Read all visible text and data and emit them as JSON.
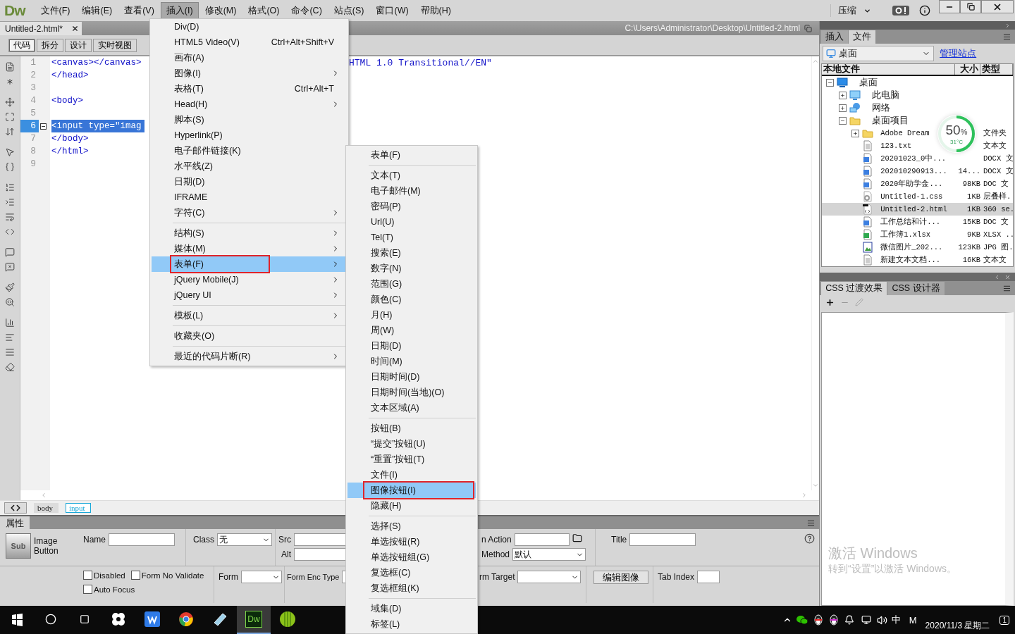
{
  "app": {
    "logo": "Dw"
  },
  "menubar": [
    {
      "label": "文件(F)",
      "selected": false
    },
    {
      "label": "编辑(E)",
      "selected": false
    },
    {
      "label": "查看(V)",
      "selected": false
    },
    {
      "label": "插入(I)",
      "selected": true
    },
    {
      "label": "修改(M)",
      "selected": false
    },
    {
      "label": "格式(O)",
      "selected": false
    },
    {
      "label": "命令(C)",
      "selected": false
    },
    {
      "label": "站点(S)",
      "selected": false
    },
    {
      "label": "窗口(W)",
      "selected": false
    },
    {
      "label": "帮助(H)",
      "selected": false
    }
  ],
  "workspace": {
    "label": "压缩"
  },
  "document": {
    "tab": "Untitled-2.html*",
    "path": "C:\\Users\\Administrator\\Desktop\\Untitled-2.html"
  },
  "view_buttons": [
    {
      "label": "代码",
      "selected": true
    },
    {
      "label": "拆分",
      "selected": false
    },
    {
      "label": "设计",
      "selected": false
    },
    {
      "label": "实时视图",
      "selected": false
    }
  ],
  "code_lines": [
    {
      "number": "1",
      "text": "<canvas></canvas>",
      "tail": "HTML 1.0 Transitional//EN\"",
      "selected": false,
      "foldable": false
    },
    {
      "number": "2",
      "text": "</head>",
      "selected": false,
      "foldable": false
    },
    {
      "number": "3",
      "selected": false,
      "foldable": false
    },
    {
      "number": "4",
      "text": "<body>",
      "selected": false,
      "foldable": false
    },
    {
      "number": "5",
      "selected": false,
      "foldable": false
    },
    {
      "number": "6",
      "text": "<input type=\"imag",
      "selected": true,
      "foldable": true
    },
    {
      "number": "7",
      "text": "</body>",
      "selected": false,
      "foldable": false
    },
    {
      "number": "8",
      "text": "</html>",
      "selected": false,
      "foldable": false
    },
    {
      "number": "9",
      "selected": false,
      "foldable": false
    }
  ],
  "tag_selector": [
    {
      "label": "body",
      "selected": false
    },
    {
      "label": "input",
      "selected": true
    }
  ],
  "properties": {
    "title": "属性",
    "element_icon_text": "Sub",
    "element_name": "Image Button",
    "name_label": "Name",
    "class": {
      "label": "Class",
      "value": "无"
    },
    "src_label": "Src",
    "alt_label": "Alt",
    "action_label": "n Action",
    "method": {
      "label": "Method",
      "value": "默认"
    },
    "title_label": "Title",
    "checkboxes": [
      {
        "label": "Disabled",
        "checked": false
      },
      {
        "label": "Form No Validate",
        "checked": false
      },
      {
        "label": "Auto Focus",
        "checked": false
      }
    ],
    "form_label": "Form",
    "enc_label": "Form Enc Type",
    "target_label": "rm Target",
    "edit_button": "编辑图像",
    "tab_index_label": "Tab Index"
  },
  "insert_menu": [
    {
      "kind": "item",
      "label": "Div(D)",
      "submenu": false,
      "selected": false,
      "outlined": false
    },
    {
      "kind": "item",
      "label": "HTML5 Video(V)",
      "shortcut": "Ctrl+Alt+Shift+V",
      "submenu": false,
      "selected": false,
      "outlined": false
    },
    {
      "kind": "item",
      "label": "画布(A)",
      "submenu": false,
      "selected": false,
      "outlined": false
    },
    {
      "kind": "item",
      "label": "图像(I)",
      "submenu": true,
      "selected": false,
      "outlined": false
    },
    {
      "kind": "item",
      "label": "表格(T)",
      "shortcut": "Ctrl+Alt+T",
      "submenu": false,
      "selected": false,
      "outlined": false
    },
    {
      "kind": "item",
      "label": "Head(H)",
      "submenu": true,
      "selected": false,
      "outlined": false
    },
    {
      "kind": "item",
      "label": "脚本(S)",
      "submenu": false,
      "selected": false,
      "outlined": false
    },
    {
      "kind": "item",
      "label": "Hyperlink(P)",
      "submenu": false,
      "selected": false,
      "outlined": false
    },
    {
      "kind": "item",
      "label": "电子邮件链接(K)",
      "submenu": false,
      "selected": false,
      "outlined": false
    },
    {
      "kind": "item",
      "label": "水平线(Z)",
      "submenu": false,
      "selected": false,
      "outlined": false
    },
    {
      "kind": "item",
      "label": "日期(D)",
      "submenu": false,
      "selected": false,
      "outlined": false
    },
    {
      "kind": "item",
      "label": "IFRAME",
      "submenu": false,
      "selected": false,
      "outlined": false
    },
    {
      "kind": "item",
      "label": "字符(C)",
      "submenu": true,
      "selected": false,
      "outlined": false
    },
    {
      "kind": "separator"
    },
    {
      "kind": "item",
      "label": "结构(S)",
      "submenu": true,
      "selected": false,
      "outlined": false
    },
    {
      "kind": "item",
      "label": "媒体(M)",
      "submenu": true,
      "selected": false,
      "outlined": false
    },
    {
      "kind": "item",
      "label": "表单(F)",
      "submenu": true,
      "selected": true,
      "outlined": true
    },
    {
      "kind": "item",
      "label": "jQuery Mobile(J)",
      "submenu": true,
      "selected": false,
      "outlined": false
    },
    {
      "kind": "item",
      "label": "jQuery UI",
      "submenu": true,
      "selected": false,
      "outlined": false
    },
    {
      "kind": "separator"
    },
    {
      "kind": "item",
      "label": "模板(L)",
      "submenu": true,
      "selected": false,
      "outlined": false
    },
    {
      "kind": "separator"
    },
    {
      "kind": "item",
      "label": "收藏夹(O)",
      "submenu": false,
      "selected": false,
      "outlined": false
    },
    {
      "kind": "separator"
    },
    {
      "kind": "item",
      "label": "最近的代码片断(R)",
      "submenu": true,
      "selected": false,
      "outlined": false
    }
  ],
  "form_submenu": [
    {
      "kind": "item",
      "label": "表单(F)",
      "selected": false,
      "outlined": false
    },
    {
      "kind": "separator"
    },
    {
      "kind": "item",
      "label": "文本(T)",
      "selected": false,
      "outlined": false
    },
    {
      "kind": "item",
      "label": "电子邮件(M)",
      "selected": false,
      "outlined": false
    },
    {
      "kind": "item",
      "label": "密码(P)",
      "selected": false,
      "outlined": false
    },
    {
      "kind": "item",
      "label": "Url(U)",
      "selected": false,
      "outlined": false
    },
    {
      "kind": "item",
      "label": "Tel(T)",
      "selected": false,
      "outlined": false
    },
    {
      "kind": "item",
      "label": "搜索(E)",
      "selected": false,
      "outlined": false
    },
    {
      "kind": "item",
      "label": "数字(N)",
      "selected": false,
      "outlined": false
    },
    {
      "kind": "item",
      "label": "范围(G)",
      "selected": false,
      "outlined": false
    },
    {
      "kind": "item",
      "label": "颜色(C)",
      "selected": false,
      "outlined": false
    },
    {
      "kind": "item",
      "label": "月(H)",
      "selected": false,
      "outlined": false
    },
    {
      "kind": "item",
      "label": "周(W)",
      "selected": false,
      "outlined": false
    },
    {
      "kind": "item",
      "label": "日期(D)",
      "selected": false,
      "outlined": false
    },
    {
      "kind": "item",
      "label": "时间(M)",
      "selected": false,
      "outlined": false
    },
    {
      "kind": "item",
      "label": "日期时间(D)",
      "selected": false,
      "outlined": false
    },
    {
      "kind": "item",
      "label": "日期时间(当地)(O)",
      "selected": false,
      "outlined": false
    },
    {
      "kind": "item",
      "label": "文本区域(A)",
      "selected": false,
      "outlined": false
    },
    {
      "kind": "separator"
    },
    {
      "kind": "item",
      "label": "按钮(B)",
      "selected": false,
      "outlined": false
    },
    {
      "kind": "item",
      "label": "“提交”按钮(U)",
      "selected": false,
      "outlined": false
    },
    {
      "kind": "item",
      "label": "“重置”按钮(T)",
      "selected": false,
      "outlined": false
    },
    {
      "kind": "item",
      "label": "文件(I)",
      "selected": false,
      "outlined": false
    },
    {
      "kind": "item",
      "label": "图像按钮(I)",
      "selected": true,
      "outlined": true
    },
    {
      "kind": "item",
      "label": "隐藏(H)",
      "selected": false,
      "outlined": false
    },
    {
      "kind": "separator"
    },
    {
      "kind": "item",
      "label": "选择(S)",
      "selected": false,
      "outlined": false
    },
    {
      "kind": "item",
      "label": "单选按钮(R)",
      "selected": false,
      "outlined": false
    },
    {
      "kind": "item",
      "label": "单选按钮组(G)",
      "selected": false,
      "outlined": false
    },
    {
      "kind": "item",
      "label": "复选框(C)",
      "selected": false,
      "outlined": false
    },
    {
      "kind": "item",
      "label": "复选框组(K)",
      "selected": false,
      "outlined": false
    },
    {
      "kind": "separator"
    },
    {
      "kind": "item",
      "label": "域集(D)",
      "selected": false,
      "outlined": false
    },
    {
      "kind": "item",
      "label": "标签(L)",
      "selected": false,
      "outlined": false
    }
  ],
  "files_panel": {
    "tabs": [
      {
        "label": "插入",
        "selected": false
      },
      {
        "label": "文件",
        "selected": true
      }
    ],
    "site": "桌面",
    "manage_link": "管理站点",
    "columns": [
      "本地文件",
      "大小",
      "类型"
    ],
    "tree": [
      {
        "label": "桌面",
        "kind": "monitor",
        "expanded": true,
        "selected": false,
        "children": [
          {
            "label": "此电脑",
            "kind": "computer",
            "expanded": false,
            "selected": false
          },
          {
            "label": "网络",
            "kind": "network",
            "expanded": false,
            "selected": false
          },
          {
            "label": "桌面项目",
            "kind": "folder",
            "expanded": true,
            "selected": false,
            "children": [
              {
                "label": "Adobe Dream",
                "kind": "folder",
                "expanded": false,
                "type": "文件夹",
                "selected": false
              },
              {
                "label": "123.txt",
                "kind": "text",
                "type": "文本文",
                "selected": false
              },
              {
                "label": "20201023_0中...",
                "kind": "word",
                "type": "DOCX 文",
                "selected": false
              },
              {
                "label": "202010290913...",
                "kind": "word",
                "size": "14...",
                "type": "DOCX 文",
                "selected": false
              },
              {
                "label": "2020年助学金...",
                "kind": "word",
                "size": "98KB",
                "type": "DOC 文",
                "selected": false
              },
              {
                "label": "Untitled-1.css",
                "kind": "css",
                "size": "1KB",
                "type": "层叠样.",
                "selected": false
              },
              {
                "label": "Untitled-2.html",
                "kind": "html",
                "size": "1KB",
                "type": "360 se.",
                "selected": true
              },
              {
                "label": "工作总结和计...",
                "kind": "word",
                "size": "15KB",
                "type": "DOC 文",
                "selected": false
              },
              {
                "label": "工作簿1.xlsx",
                "kind": "excel",
                "size": "9KB",
                "type": "XLSX ..",
                "selected": false
              },
              {
                "label": "微信图片_202...",
                "kind": "image",
                "size": "123KB",
                "type": "JPG 图.",
                "selected": false
              },
              {
                "label": "新建文本文档...",
                "kind": "text",
                "size": "16KB",
                "type": "文本文",
                "selected": false
              }
            ]
          }
        ]
      }
    ]
  },
  "cpu_widget": {
    "value": "50",
    "unit": "%",
    "temperature": "31°C",
    "level": 0.5
  },
  "css_panel": {
    "tabs": [
      {
        "label": "CSS 过渡效果",
        "selected": true
      },
      {
        "label": "CSS 设计器",
        "selected": false
      }
    ]
  },
  "activation_notice": {
    "title": "激活 Windows",
    "text": "转到“设置”以激活 Windows。"
  },
  "taskbar": {
    "apps": [
      {
        "kind": "pinwheel",
        "selected": false
      },
      {
        "kind": "wps",
        "selected": false
      },
      {
        "kind": "chrome",
        "selected": false
      },
      {
        "kind": "notes",
        "selected": false
      },
      {
        "kind": "dreamweaver",
        "label": "Dw",
        "selected": true
      },
      {
        "kind": "melon",
        "selected": false
      }
    ],
    "ime": "中",
    "ime_mode": "M",
    "date": "2020/11/3 星期二",
    "notifications": "1"
  }
}
